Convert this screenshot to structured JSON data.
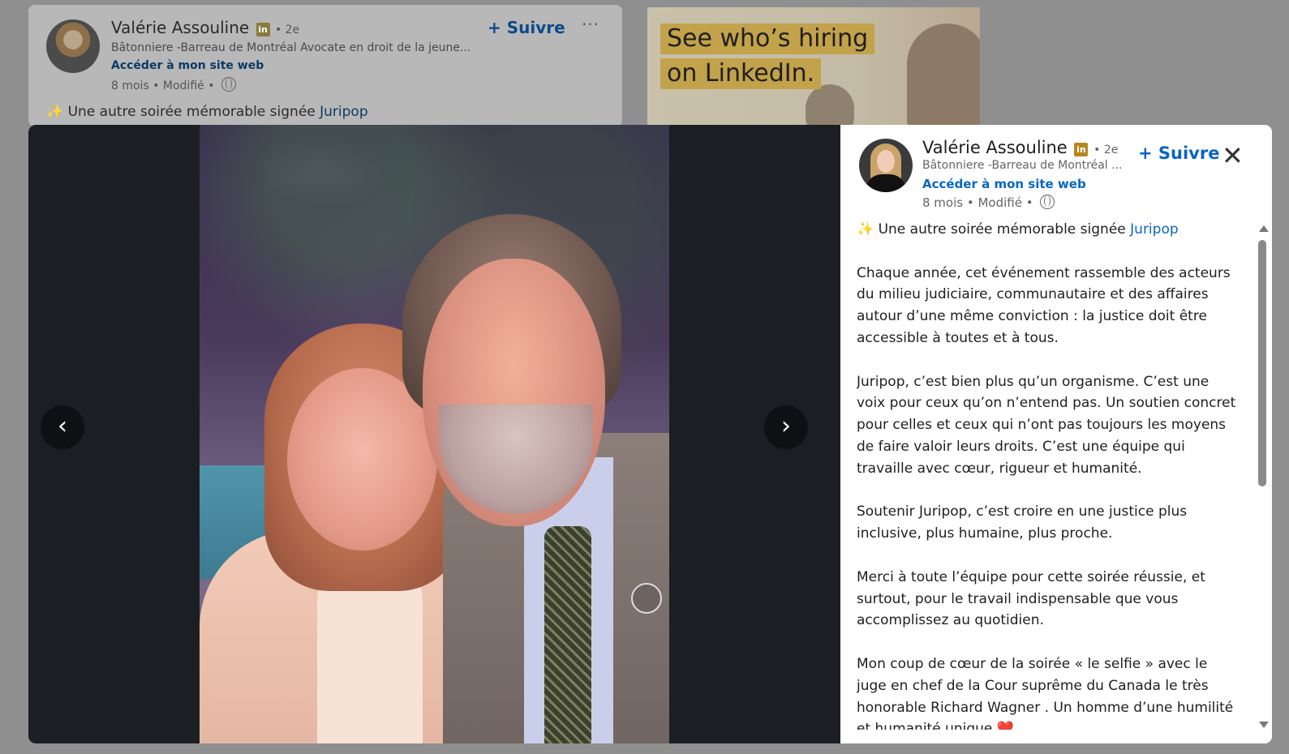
{
  "feed_post": {
    "author_name": "Valérie Assouline",
    "badge": "in",
    "degree": "• 2e",
    "headline": "Bâtonniere -Barreau de Montréal Avocate en droit de la jeune...",
    "website_link": "Accéder à mon site web",
    "meta": "8 mois • Modifié •",
    "follow_label": "+ Suivre",
    "more_label": "···",
    "text_prefix": "✨ Une autre soirée mémorable signée ",
    "text_link": "Juripop"
  },
  "ad": {
    "line1": "See who’s hiring",
    "line2": "on LinkedIn."
  },
  "viewer": {
    "prev_label": "‹",
    "next_label": "›"
  },
  "panel": {
    "author_name": "Valérie Assouline",
    "badge": "in",
    "degree": "• 2e",
    "headline": "Bâtonniere -Barreau de Montréal ...",
    "website_link": "Accéder à mon site web",
    "meta": "8 mois • Modifié •",
    "follow_label": "+ Suivre",
    "close_label": "✕",
    "intro_icon": "✨",
    "intro_text": " Une autre soirée mémorable signée ",
    "intro_link": "Juripop",
    "paragraphs": [
      "Chaque année, cet événement rassemble des acteurs du milieu judiciaire, communautaire et des affaires autour d’une même conviction : la justice doit être accessible à toutes et à tous.",
      "Juripop, c’est bien plus qu’un organisme. C’est une voix pour ceux qu’on n’entend pas. Un soutien concret pour celles et ceux qui n’ont pas toujours les moyens de faire valoir leurs droits. C’est une équipe qui travaille avec cœur, rigueur et humanité.",
      "Soutenir Juripop, c’est croire en une justice plus inclusive, plus humaine, plus proche.",
      "Merci à toute l’équipe pour cette soirée réussie, et surtout, pour le travail indispensable que vous accomplissez au quotidien.",
      "Mon coup de cœur de la soirée «  le selfie » avec le juge en chef de la Cour suprême du Canada le très honorable Richard Wagner . Un homme d’une humilité et humanité unique ❤️"
    ]
  },
  "colors": {
    "link_blue": "#0a66c2",
    "viewer_bg": "#1b1f23",
    "overlay": "#8f8f8f"
  },
  "icons": [
    "linkedin-badge-icon",
    "globe-icon",
    "chevron-left-icon",
    "chevron-right-icon",
    "close-icon",
    "sparkles-icon",
    "more-icon"
  ]
}
